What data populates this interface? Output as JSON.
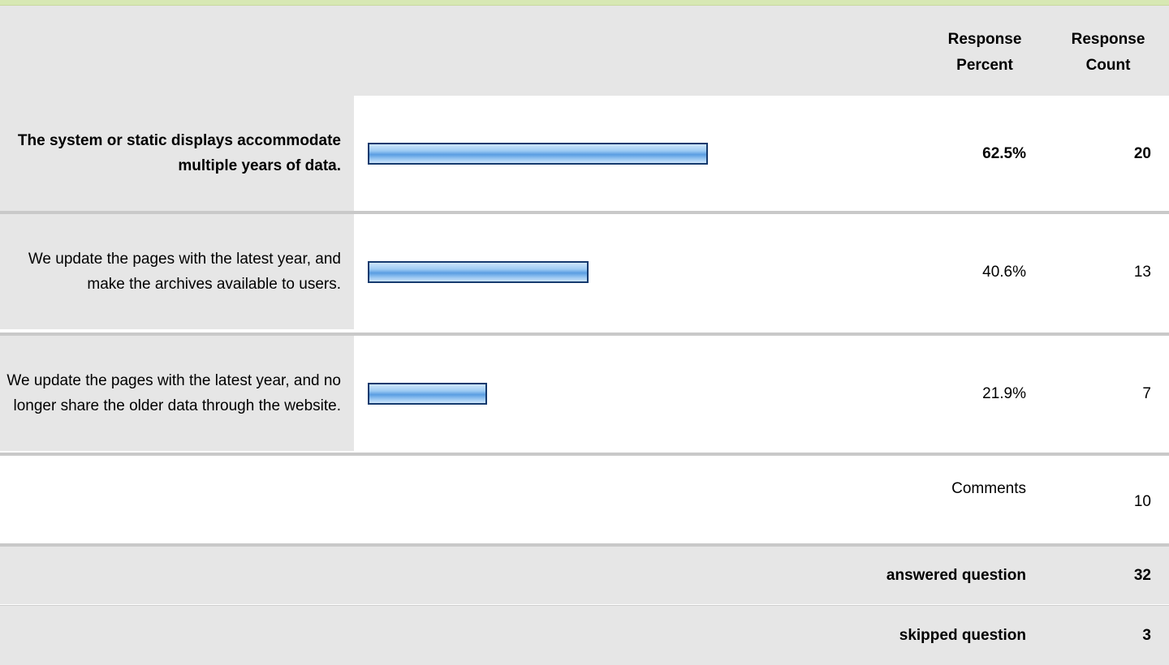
{
  "header": {
    "response_percent": "Response\nPercent",
    "response_count": "Response\nCount"
  },
  "chart_data": {
    "type": "bar",
    "categories": [
      "The system or static displays accommodate multiple years of data.",
      "We update the pages with the latest year, and make the archives available to users.",
      "We update the pages with the latest year, and no longer share the older data through the website."
    ],
    "values": [
      62.5,
      40.6,
      21.9
    ],
    "counts": [
      20,
      13,
      7
    ],
    "value_labels": [
      "62.5%",
      "40.6%",
      "21.9%"
    ],
    "count_labels": [
      "20",
      "13",
      "7"
    ],
    "xlim": [
      0,
      100
    ]
  },
  "comments": {
    "label": "Comments",
    "count": "10"
  },
  "summary": {
    "answered_label": "answered question",
    "answered_value": "32",
    "skipped_label": "skipped question",
    "skipped_value": "3"
  },
  "colors": {
    "bar_fill": "#7fb6ee",
    "bar_border": "#153a6e",
    "header_bg": "#e6e6e6",
    "accent_line": "#d7e8b3"
  }
}
